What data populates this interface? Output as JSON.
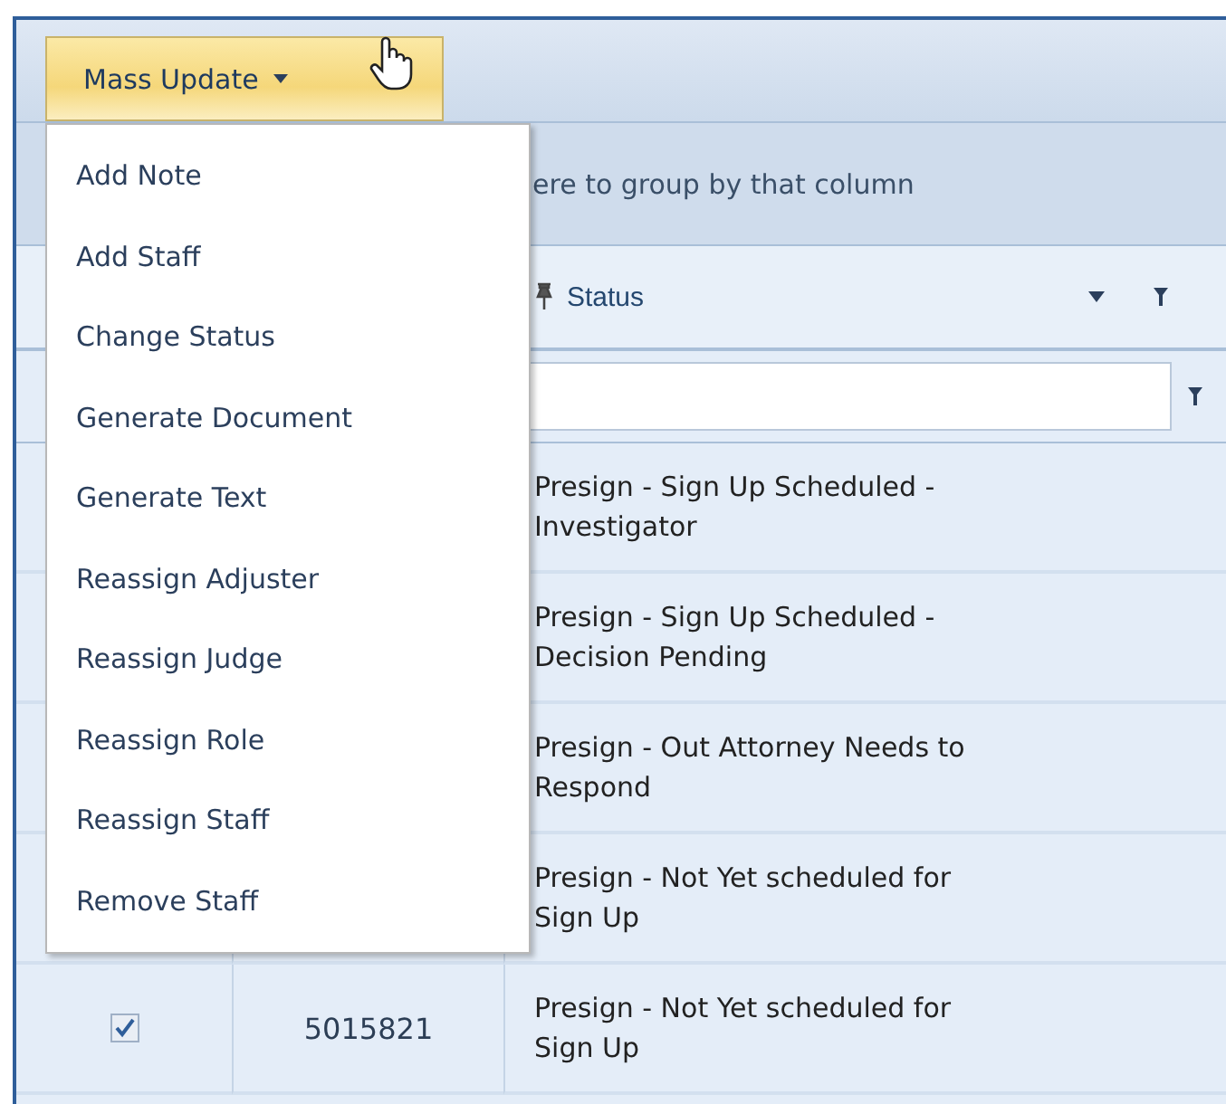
{
  "toolbar": {
    "mass_update_button": "Mass Update"
  },
  "menu": {
    "items": [
      "Add Note",
      "Add Staff",
      "Change Status",
      "Generate Document",
      "Generate Text",
      "Reassign Adjuster",
      "Reassign Judge",
      "Reassign Role",
      "Reassign Staff",
      "Remove Staff"
    ]
  },
  "group_panel": {
    "hint": "ere to group by that column"
  },
  "columns": [
    {
      "label": "Status"
    }
  ],
  "rows": [
    {
      "status": "Presign - Sign Up Scheduled - Investigator"
    },
    {
      "status": "Presign - Sign Up Scheduled - Decision Pending"
    },
    {
      "status": "Presign - Out Attorney Needs to Respond"
    },
    {
      "status": "Presign - Not Yet scheduled for Sign Up"
    },
    {
      "checked": true,
      "id": "5015821",
      "status": "Presign - Not Yet scheduled for Sign Up"
    }
  ]
}
